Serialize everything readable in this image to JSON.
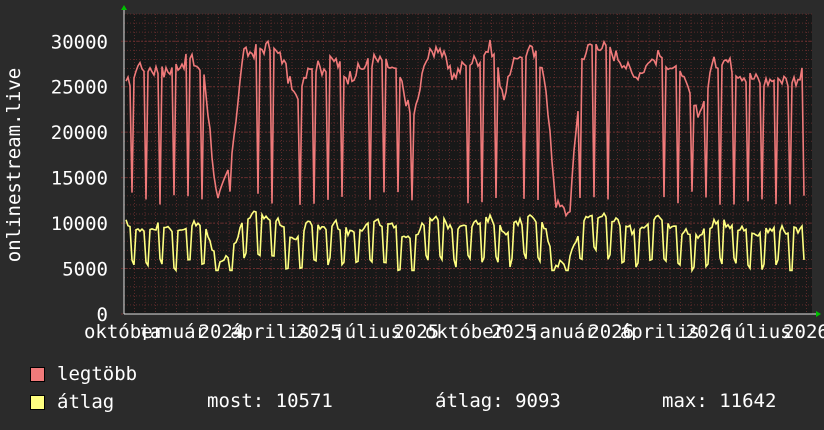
{
  "chart_data": {
    "type": "line",
    "ylabel": "onlinestream.live",
    "ylim": [
      0,
      33000
    ],
    "yticks": [
      0,
      5000,
      10000,
      15000,
      20000,
      25000,
      30000
    ],
    "x_tick_labels": [
      "október",
      "január",
      "2024",
      "április",
      "2025",
      "július",
      "2025",
      "október",
      "2025",
      "január",
      "2026",
      "április",
      "2026",
      "július",
      "2026"
    ],
    "grid": true,
    "legend_position": "bottom-left",
    "series": [
      {
        "name": "legtöbb",
        "color": "#f07a7a",
        "approx_values": [
          25000,
          27500,
          27000,
          26500,
          27500,
          28000,
          26500,
          12000,
          16500,
          28500,
          29000,
          29500,
          28000,
          23500,
          27500,
          27000,
          28000,
          26000,
          27000,
          28000,
          27500,
          26000,
          21000,
          28000,
          29500,
          26000,
          27500,
          28000,
          29500,
          24000,
          28500,
          29000,
          27500,
          12000,
          11000,
          28500,
          30000,
          29000,
          28000,
          26000,
          27500,
          28500,
          27000,
          25000,
          22000,
          27500,
          28000,
          26500,
          26000,
          25500,
          26000,
          25500,
          26500
        ]
      },
      {
        "name": "átlag",
        "color": "#ffff80",
        "approx_values": [
          10000,
          9000,
          9500,
          10000,
          9000,
          10000,
          9500,
          6000,
          6500,
          10500,
          11000,
          10500,
          10000,
          8000,
          10000,
          9500,
          10000,
          9000,
          9500,
          10000,
          10000,
          9000,
          8500,
          10000,
          10500,
          9500,
          10000,
          10000,
          10500,
          9000,
          10000,
          10500,
          10000,
          5500,
          6000,
          10500,
          11000,
          10500,
          10000,
          9000,
          10000,
          10500,
          9500,
          9000,
          8500,
          10000,
          10000,
          9500,
          9000,
          9000,
          9500,
          9000,
          9500
        ]
      }
    ]
  },
  "legend": [
    {
      "label": "legtöbb",
      "color": "#f07a7a"
    },
    {
      "label": "átlag",
      "color": "#ffff80"
    }
  ],
  "stats": {
    "most": "most: 10571",
    "atlag": "átlag: 9093",
    "max": "max: 11642"
  }
}
